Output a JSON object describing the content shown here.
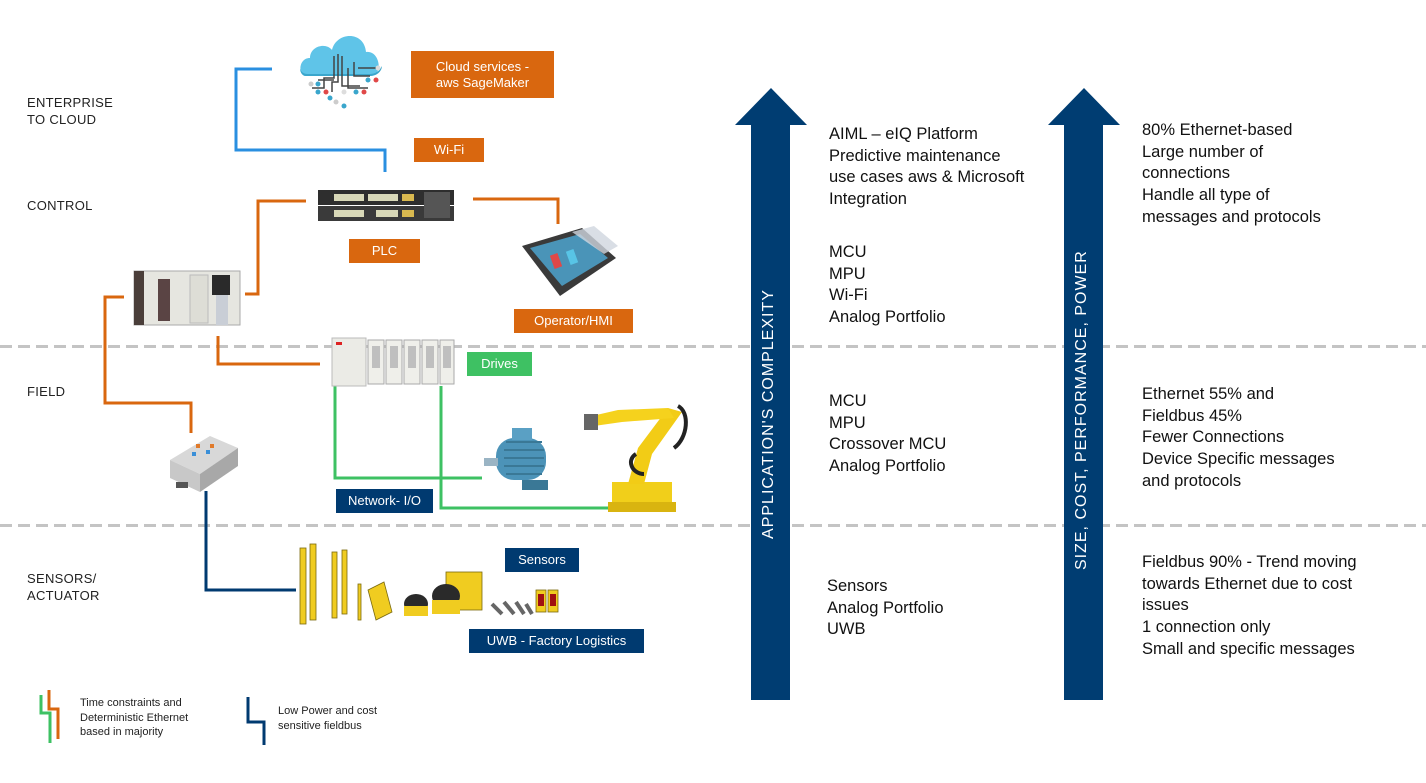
{
  "levels": [
    {
      "id": "enterprise",
      "label": "ENTERPRISE\nTO CLOUD"
    },
    {
      "id": "control",
      "label": "CONTROL"
    },
    {
      "id": "field",
      "label": "FIELD"
    },
    {
      "id": "sensors",
      "label": "SENSORS/\nACTUATOR"
    }
  ],
  "tags": {
    "cloud": "Cloud services -\naws SageMaker",
    "wifi": "Wi-Fi",
    "plc": "PLC",
    "hmi": "Operator/HMI",
    "drives": "Drives",
    "network_io": "Network- I/O",
    "sensors": "Sensors",
    "uwb": "UWB - Factory Logistics"
  },
  "devices": {
    "cloud": "cloud-icon",
    "switch": "network-switch",
    "plc_rack": "plc-rack",
    "hmi": "hmi-panel",
    "drives": "drive-modules",
    "io_module": "remote-io-module",
    "motor": "electric-motor",
    "robot": "industrial-robot-arm",
    "sensors": "safety-sensors-lineup"
  },
  "arrows": {
    "left": "APPLICATION'S  COMPLEXITY",
    "right": "SIZE, COST, PERFORMANCE, POWER"
  },
  "complexity_text": {
    "enterprise": "AIML – eIQ Platform\nPredictive maintenance\nuse cases aws & Microsoft\nIntegration",
    "control": "MCU\nMPU\nWi-Fi\nAnalog Portfolio",
    "field": "MCU\nMPU\nCrossover MCU\nAnalog Portfolio",
    "sensors": "Sensors\nAnalog Portfolio\nUWB"
  },
  "network_text": {
    "top": "80% Ethernet-based\nLarge number of\nconnections\nHandle all type of\nmessages and protocols",
    "field": "Ethernet 55% and\nFieldbus 45%\nFewer Connections\nDevice Specific messages\nand protocols",
    "sensors": "Fieldbus 90% - Trend moving\ntowards Ethernet due to cost\nissues\n1 connection only\nSmall and specific messages"
  },
  "legend": [
    {
      "icon": "orange-green-line-icon",
      "text": "Time constraints and\nDeterministic Ethernet\nbased in majority"
    },
    {
      "icon": "navy-line-icon",
      "text": "Low Power and cost\nsensitive fieldbus"
    }
  ],
  "colors": {
    "orange": "#d9670f",
    "green": "#3ec163",
    "navy": "#003a70",
    "wifi_blue": "#2a8fe0",
    "separator": "#c4c4c4"
  }
}
